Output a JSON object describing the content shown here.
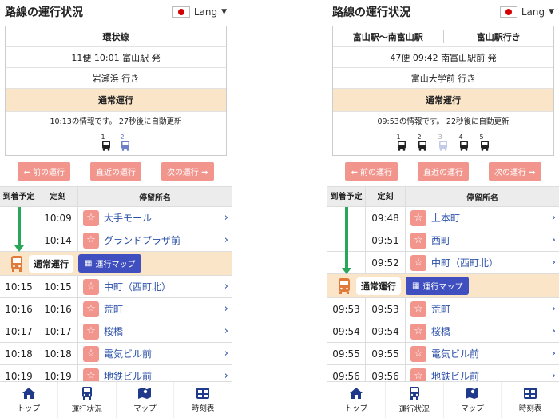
{
  "colors": {
    "accent_pink": "#f2958d",
    "status_bg": "#fbe5c8",
    "link_blue": "#2a4fa8",
    "map_button": "#3f4fbf",
    "arrow_green": "#2aa65a"
  },
  "left": {
    "header": {
      "title": "路線の運行状況",
      "lang_label": "Lang"
    },
    "card": {
      "route_name": "環状線",
      "trip": "11便 10:01 富山駅 発",
      "destination": "岩瀬浜 行き",
      "status": "通常運行",
      "info": "10:13の情報です。 27秒後に自動更新",
      "buses": [
        "1",
        "2"
      ]
    },
    "nav": {
      "prev": "前の運行",
      "nearest": "直近の運行",
      "next": "次の運行"
    },
    "table": {
      "headers": {
        "arrival": "到着予定",
        "scheduled": "定刻",
        "stop": "停留所名"
      },
      "rows_before": [
        {
          "arrival": "",
          "scheduled": "10:09",
          "stop": "大手モール"
        },
        {
          "arrival": "",
          "scheduled": "10:14",
          "stop": "グランドプラザ前"
        }
      ],
      "banner": {
        "status": "通常運行",
        "map": "運行マップ"
      },
      "rows_after": [
        {
          "arrival": "10:15",
          "scheduled": "10:15",
          "stop": "中町（西町北）"
        },
        {
          "arrival": "10:16",
          "scheduled": "10:16",
          "stop": "荒町"
        },
        {
          "arrival": "10:17",
          "scheduled": "10:17",
          "stop": "桜橋"
        },
        {
          "arrival": "10:18",
          "scheduled": "10:18",
          "stop": "電気ビル前"
        },
        {
          "arrival": "10:19",
          "scheduled": "10:19",
          "stop": "地鉄ビル前"
        }
      ]
    },
    "tabs": [
      "トップ",
      "運行状況",
      "マップ",
      "時刻表"
    ]
  },
  "right": {
    "header": {
      "title": "路線の運行状況",
      "lang_label": "Lang"
    },
    "card": {
      "route_from": "富山駅〜南富山駅",
      "route_to": "富山駅行き",
      "trip": "47便 09:42 南富山駅前 発",
      "destination": "富山大学前 行き",
      "status": "通常運行",
      "info": "09:53の情報です。 22秒後に自動更新",
      "buses": [
        "1",
        "2",
        "3",
        "4",
        "5"
      ]
    },
    "nav": {
      "prev": "前の運行",
      "nearest": "直近の運行",
      "next": "次の運行"
    },
    "table": {
      "headers": {
        "arrival": "到着予定",
        "scheduled": "定刻",
        "stop": "停留所名"
      },
      "rows_before": [
        {
          "arrival": "",
          "scheduled": "09:48",
          "stop": "上本町"
        },
        {
          "arrival": "",
          "scheduled": "09:51",
          "stop": "西町"
        },
        {
          "arrival": "",
          "scheduled": "09:52",
          "stop": "中町（西町北）"
        }
      ],
      "banner": {
        "status": "通常運行",
        "map": "運行マップ"
      },
      "rows_after": [
        {
          "arrival": "09:53",
          "scheduled": "09:53",
          "stop": "荒町"
        },
        {
          "arrival": "09:54",
          "scheduled": "09:54",
          "stop": "桜橋"
        },
        {
          "arrival": "09:55",
          "scheduled": "09:55",
          "stop": "電気ビル前"
        },
        {
          "arrival": "09:56",
          "scheduled": "09:56",
          "stop": "地鉄ビル前"
        }
      ]
    },
    "tabs": [
      "トップ",
      "運行状況",
      "マップ",
      "時刻表"
    ]
  }
}
